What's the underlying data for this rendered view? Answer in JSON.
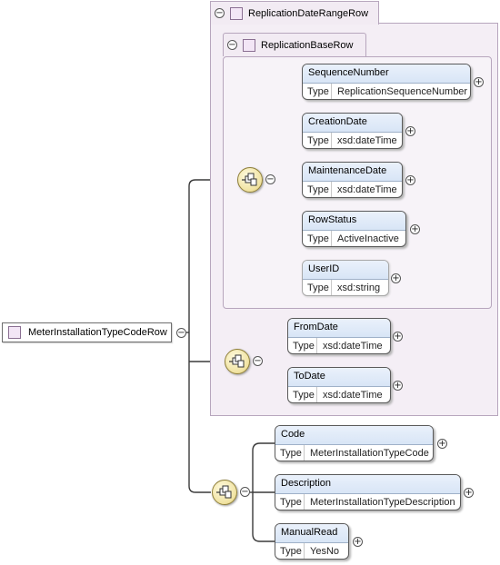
{
  "root": {
    "label": "MeterInstallationTypeCodeRow"
  },
  "groups": {
    "outer": {
      "label": "ReplicationDateRangeRow"
    },
    "inner": {
      "label": "ReplicationBaseRow"
    }
  },
  "type_key": "Type",
  "elements": {
    "sequence_number": {
      "name": "SequenceNumber",
      "type": "ReplicationSequenceNumber"
    },
    "creation_date": {
      "name": "CreationDate",
      "type": "xsd:dateTime"
    },
    "maintenance_date": {
      "name": "MaintenanceDate",
      "type": "xsd:dateTime"
    },
    "row_status": {
      "name": "RowStatus",
      "type": "ActiveInactive"
    },
    "user_id": {
      "name": "UserID",
      "type": "xsd:string"
    },
    "from_date": {
      "name": "FromDate",
      "type": "xsd:dateTime"
    },
    "to_date": {
      "name": "ToDate",
      "type": "xsd:dateTime"
    },
    "code": {
      "name": "Code",
      "type": "MeterInstallationTypeCode"
    },
    "description": {
      "name": "Description",
      "type": "MeterInstallationTypeDescription"
    },
    "manual_read": {
      "name": "ManualRead",
      "type": "YesNo"
    }
  },
  "icons": {
    "collapse": "minus-toggle-icon",
    "expand": "plus-toggle-icon",
    "sequence": "sequence-compositor-icon",
    "group": "complex-type-square-icon"
  },
  "glyphs": {
    "minus": "−",
    "plus": "+"
  },
  "colors": {
    "group_fill": "#f4eef5",
    "group_border": "#b7a6bd",
    "element_header": "#d8e5f6",
    "compositor_fill": "#f0e2a0"
  }
}
